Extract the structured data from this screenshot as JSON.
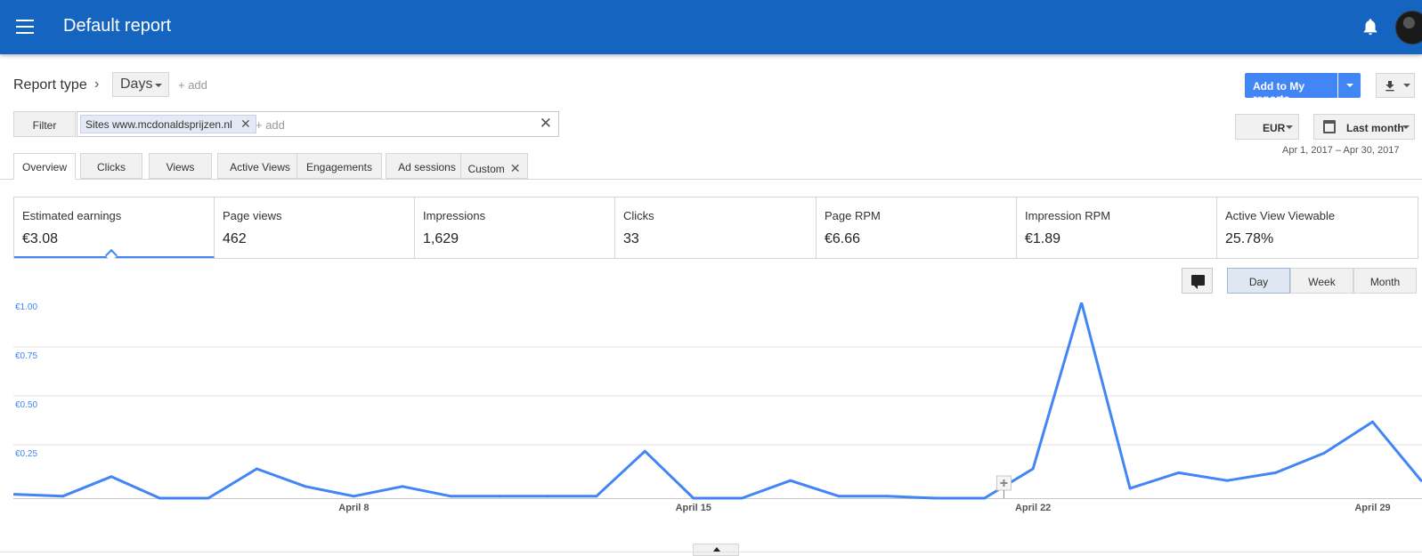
{
  "header": {
    "title": "Default report",
    "bg_color": "#1565c0",
    "icons": [
      "menu-icon",
      "bell-icon",
      "avatar"
    ]
  },
  "report": {
    "report_type_label": "Report type",
    "breadcrumb_sep": "›",
    "dimension": "Days",
    "add_label": "+ add",
    "add_to_reports": "Add to My reports"
  },
  "filter": {
    "button": "Filter",
    "chip": "Sites www.mcdonaldsprijzen.nl",
    "chip_remove": "✕",
    "add_placeholder": "+ add",
    "clear": "✕"
  },
  "controls": {
    "currency": "EUR",
    "date_preset": "Last month",
    "date_range": "Apr 1, 2017 – Apr 30, 2017"
  },
  "tabs": [
    {
      "label": "Overview",
      "active": true
    },
    {
      "label": "Clicks"
    },
    {
      "label": "Views"
    },
    {
      "label": "Active Views"
    },
    {
      "label": "Engagements"
    },
    {
      "label": "Ad sessions"
    },
    {
      "label": "Custom",
      "closable": true,
      "close": "✕"
    }
  ],
  "metrics": [
    {
      "label": "Estimated earnings",
      "value": "€3.08",
      "selected": true
    },
    {
      "label": "Page views",
      "value": "462"
    },
    {
      "label": "Impressions",
      "value": "1,629"
    },
    {
      "label": "Clicks",
      "value": "33"
    },
    {
      "label": "Page RPM",
      "value": "€6.66"
    },
    {
      "label": "Impression RPM",
      "value": "€1.89"
    },
    {
      "label": "Active View Viewable",
      "value": "25.78%"
    }
  ],
  "period": {
    "buttons": [
      "Day",
      "Week",
      "Month"
    ],
    "active": "Day"
  },
  "chart_data": {
    "type": "line",
    "series_color": "#4285f4",
    "ylim": [
      0,
      1.0
    ],
    "ytick_values": [
      0.25,
      0.5,
      0.75,
      1.0
    ],
    "yticks": [
      "€0.25",
      "€0.50",
      "€0.75",
      "€1.00"
    ],
    "xtick_days": [
      8,
      15,
      22,
      29
    ],
    "xticks": [
      "April 8",
      "April 15",
      "April 22",
      "April 29"
    ],
    "x": [
      1,
      2,
      3,
      4,
      5,
      6,
      7,
      8,
      9,
      10,
      11,
      12,
      13,
      14,
      15,
      16,
      17,
      18,
      19,
      20,
      21,
      22,
      23,
      24,
      25,
      26,
      27,
      28,
      29,
      30
    ],
    "series": [
      {
        "values": [
          0.02,
          0.01,
          0.11,
          0.0,
          0.0,
          0.15,
          0.06,
          0.01,
          0.06,
          0.01,
          0.01,
          0.01,
          0.01,
          0.24,
          0.0,
          0.0,
          0.09,
          0.01,
          0.01,
          0.0,
          0.0,
          0.15,
          1.0,
          0.05,
          0.13,
          0.09,
          0.13,
          0.23,
          0.39,
          0.09
        ]
      }
    ],
    "grid": true
  }
}
